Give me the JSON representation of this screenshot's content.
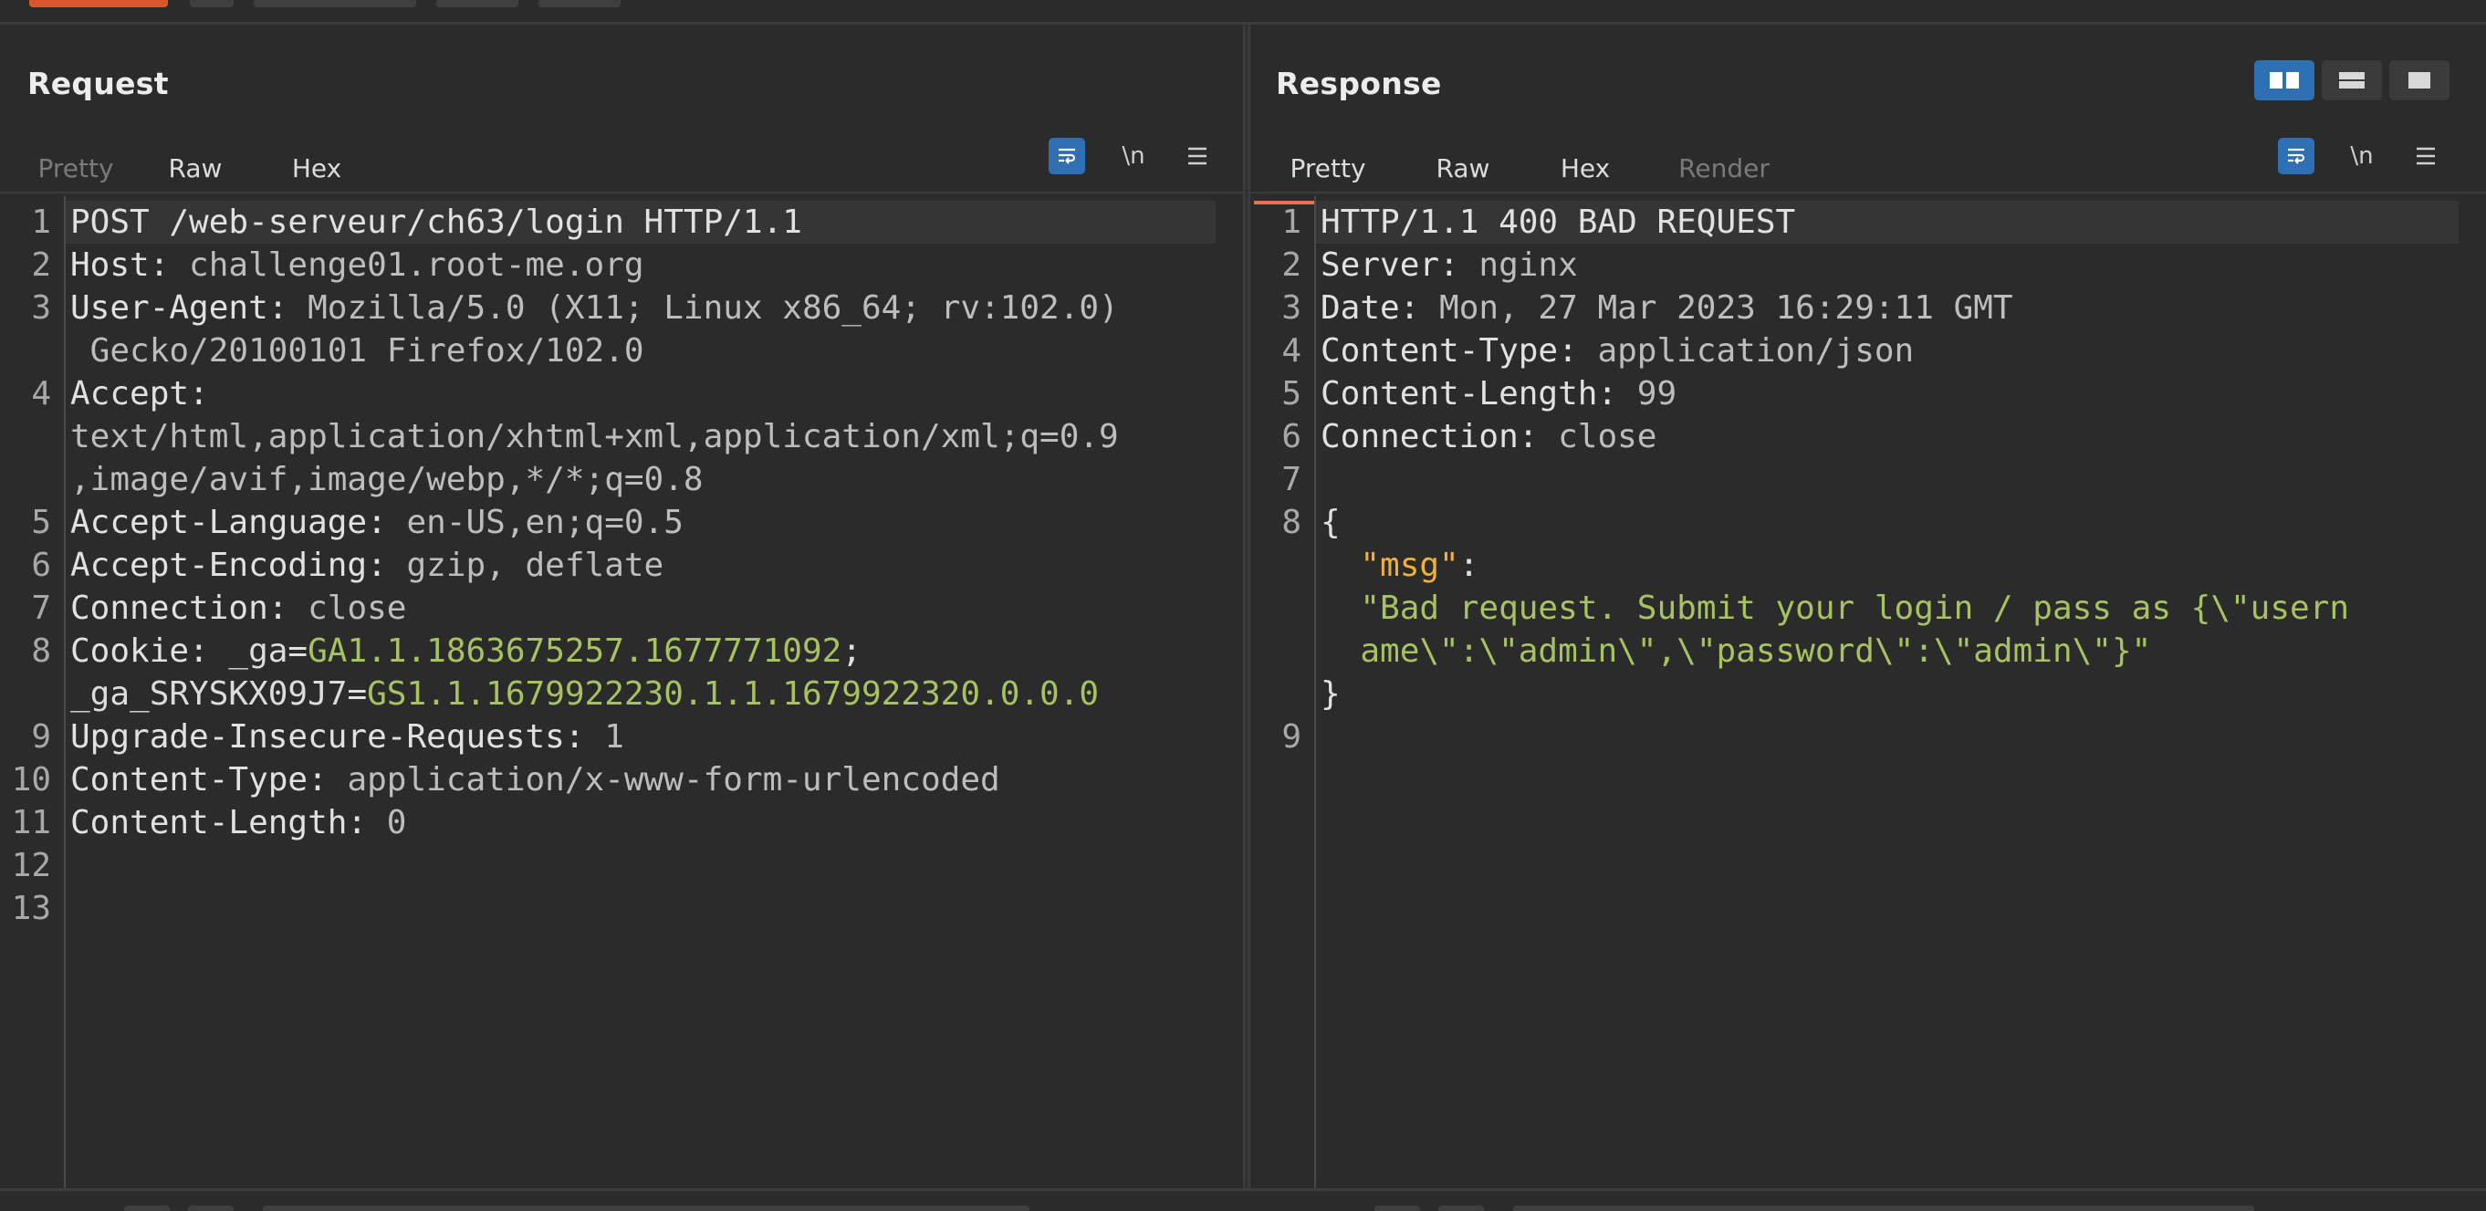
{
  "request": {
    "title": "Request",
    "tabs": [
      {
        "label": "Pretty",
        "state": "disabled"
      },
      {
        "label": "Raw",
        "state": "active"
      },
      {
        "label": "Hex",
        "state": "normal"
      }
    ],
    "tools": {
      "newline_label": "\\n"
    },
    "lines": [
      {
        "n": "1",
        "segs": [
          {
            "t": "POST /web-serveur/ch63/login HTTP/1.1",
            "c": "k"
          }
        ]
      },
      {
        "n": "2",
        "segs": [
          {
            "t": "Host: ",
            "c": "k"
          },
          {
            "t": "challenge01.root-me.org",
            "c": "v"
          }
        ]
      },
      {
        "n": "3",
        "segs": [
          {
            "t": "User-Agent: ",
            "c": "k"
          },
          {
            "t": "Mozilla/5.0 (X11; Linux x86_64; rv:102.0)",
            "c": "v"
          }
        ]
      },
      {
        "n": "",
        "segs": [
          {
            "t": " Gecko/20100101 Firefox/102.0",
            "c": "v"
          }
        ]
      },
      {
        "n": "4",
        "segs": [
          {
            "t": "Accept:",
            "c": "k"
          }
        ]
      },
      {
        "n": "",
        "segs": [
          {
            "t": "text/html,application/xhtml+xml,application/xml;q=0.9",
            "c": "v"
          }
        ]
      },
      {
        "n": "",
        "segs": [
          {
            "t": ",image/avif,image/webp,*/*;q=0.8",
            "c": "v"
          }
        ]
      },
      {
        "n": "5",
        "segs": [
          {
            "t": "Accept-Language: ",
            "c": "k"
          },
          {
            "t": "en-US,en;q=0.5",
            "c": "v"
          }
        ]
      },
      {
        "n": "6",
        "segs": [
          {
            "t": "Accept-Encoding: ",
            "c": "k"
          },
          {
            "t": "gzip, deflate",
            "c": "v"
          }
        ]
      },
      {
        "n": "7",
        "segs": [
          {
            "t": "Connection: ",
            "c": "k"
          },
          {
            "t": "close",
            "c": "v"
          }
        ]
      },
      {
        "n": "8",
        "segs": [
          {
            "t": "Cookie: ",
            "c": "k"
          },
          {
            "t": "_ga",
            "c": "ck"
          },
          {
            "t": "=",
            "c": "k"
          },
          {
            "t": "GA1.1.1863675257.1677771092",
            "c": "cv"
          },
          {
            "t": ";",
            "c": "k"
          }
        ]
      },
      {
        "n": "",
        "segs": [
          {
            "t": "_ga_SRYSKX09J7",
            "c": "ck"
          },
          {
            "t": "=",
            "c": "k"
          },
          {
            "t": "GS1.1.1679922230.1.1.1679922320.0.0.0",
            "c": "cv"
          }
        ]
      },
      {
        "n": "9",
        "segs": [
          {
            "t": "Upgrade-Insecure-Requests: ",
            "c": "k"
          },
          {
            "t": "1",
            "c": "v"
          }
        ]
      },
      {
        "n": "10",
        "segs": [
          {
            "t": "Content-Type: ",
            "c": "k"
          },
          {
            "t": "application/x-www-form-urlencoded",
            "c": "v"
          }
        ]
      },
      {
        "n": "11",
        "segs": [
          {
            "t": "Content-Length: ",
            "c": "k"
          },
          {
            "t": "0",
            "c": "v"
          }
        ]
      },
      {
        "n": "12",
        "segs": []
      },
      {
        "n": "13",
        "segs": []
      }
    ]
  },
  "response": {
    "title": "Response",
    "tabs": [
      {
        "label": "Pretty",
        "state": "active"
      },
      {
        "label": "Raw",
        "state": "normal"
      },
      {
        "label": "Hex",
        "state": "normal"
      },
      {
        "label": "Render",
        "state": "disabled"
      }
    ],
    "tools": {
      "newline_label": "\\n"
    },
    "lines": [
      {
        "n": "1",
        "segs": [
          {
            "t": "HTTP/1.1 400 BAD REQUEST",
            "c": "k"
          }
        ]
      },
      {
        "n": "2",
        "segs": [
          {
            "t": "Server: ",
            "c": "k"
          },
          {
            "t": "nginx",
            "c": "v"
          }
        ]
      },
      {
        "n": "3",
        "segs": [
          {
            "t": "Date: ",
            "c": "k"
          },
          {
            "t": "Mon, 27 Mar 2023 16:29:11 GMT",
            "c": "v"
          }
        ]
      },
      {
        "n": "4",
        "segs": [
          {
            "t": "Content-Type: ",
            "c": "k"
          },
          {
            "t": "application/json",
            "c": "v"
          }
        ]
      },
      {
        "n": "5",
        "segs": [
          {
            "t": "Content-Length: ",
            "c": "k"
          },
          {
            "t": "99",
            "c": "v"
          }
        ]
      },
      {
        "n": "6",
        "segs": [
          {
            "t": "Connection: ",
            "c": "k"
          },
          {
            "t": "close",
            "c": "v"
          }
        ]
      },
      {
        "n": "7",
        "segs": []
      },
      {
        "n": "8",
        "segs": [
          {
            "t": "{",
            "c": "k"
          }
        ]
      },
      {
        "n": "",
        "segs": [
          {
            "t": "  ",
            "c": "k"
          },
          {
            "t": "\"msg\"",
            "c": "jk"
          },
          {
            "t": ":",
            "c": "k"
          }
        ]
      },
      {
        "n": "",
        "segs": [
          {
            "t": "  ",
            "c": "k"
          },
          {
            "t": "\"Bad request. Submit your login / pass as {\\\"usern",
            "c": "js"
          }
        ]
      },
      {
        "n": "",
        "segs": [
          {
            "t": "  ",
            "c": "k"
          },
          {
            "t": "ame\\\":\\\"admin\\\",\\\"password\\\":\\\"admin\\\"}\"",
            "c": "js"
          }
        ]
      },
      {
        "n": "",
        "segs": [
          {
            "t": "}",
            "c": "k"
          }
        ]
      },
      {
        "n": "9",
        "segs": []
      }
    ]
  }
}
